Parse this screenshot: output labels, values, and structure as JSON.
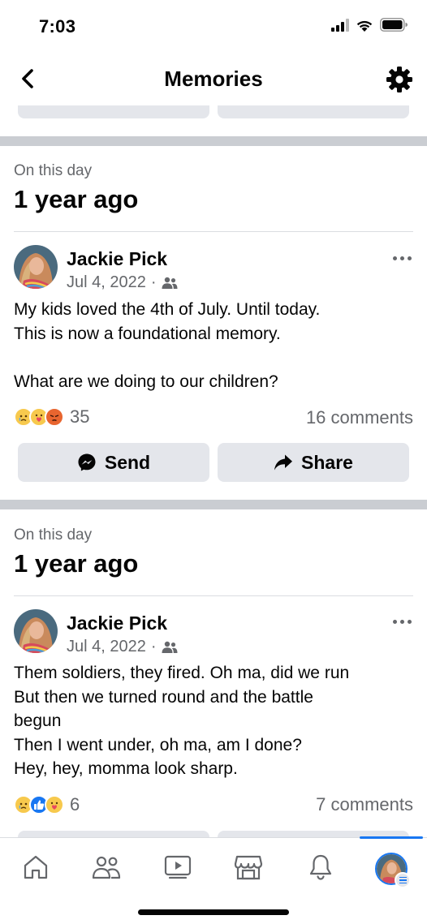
{
  "status": {
    "time": "7:03"
  },
  "header": {
    "title": "Memories"
  },
  "memories": [
    {
      "label": "On this day",
      "ago": "1 year ago",
      "author": "Jackie Pick",
      "date": "Jul 4, 2022",
      "dot": "·",
      "audience_icon": "friends-icon",
      "text": "My kids loved the 4th of July. Until today.\nThis is now a foundational memory.\n\nWhat are we doing to our children?",
      "reaction_icons": [
        "sad",
        "care",
        "angry"
      ],
      "reaction_count": "35",
      "comments": "16 comments",
      "send_label": "Send",
      "share_label": "Share"
    },
    {
      "label": "On this day",
      "ago": "1 year ago",
      "author": "Jackie Pick",
      "date": "Jul 4, 2022",
      "dot": "·",
      "audience_icon": "friends-icon",
      "text": "Them soldiers, they fired. Oh ma, did we run\nBut then we turned round and the battle\nbegun\nThen I went under, oh ma, am I done?\nHey, hey, momma look sharp.",
      "reaction_icons": [
        "sad",
        "like",
        "care"
      ],
      "reaction_count": "6",
      "comments": "7 comments"
    }
  ],
  "nav": [
    "home-icon",
    "friends-icon",
    "video-icon",
    "marketplace-icon",
    "notifications-icon",
    "profile-menu-icon"
  ],
  "colors": {
    "accent": "#1877f2",
    "divider": "#cacdd2",
    "button_bg": "#e4e6eb",
    "secondary_text": "#65676b"
  }
}
